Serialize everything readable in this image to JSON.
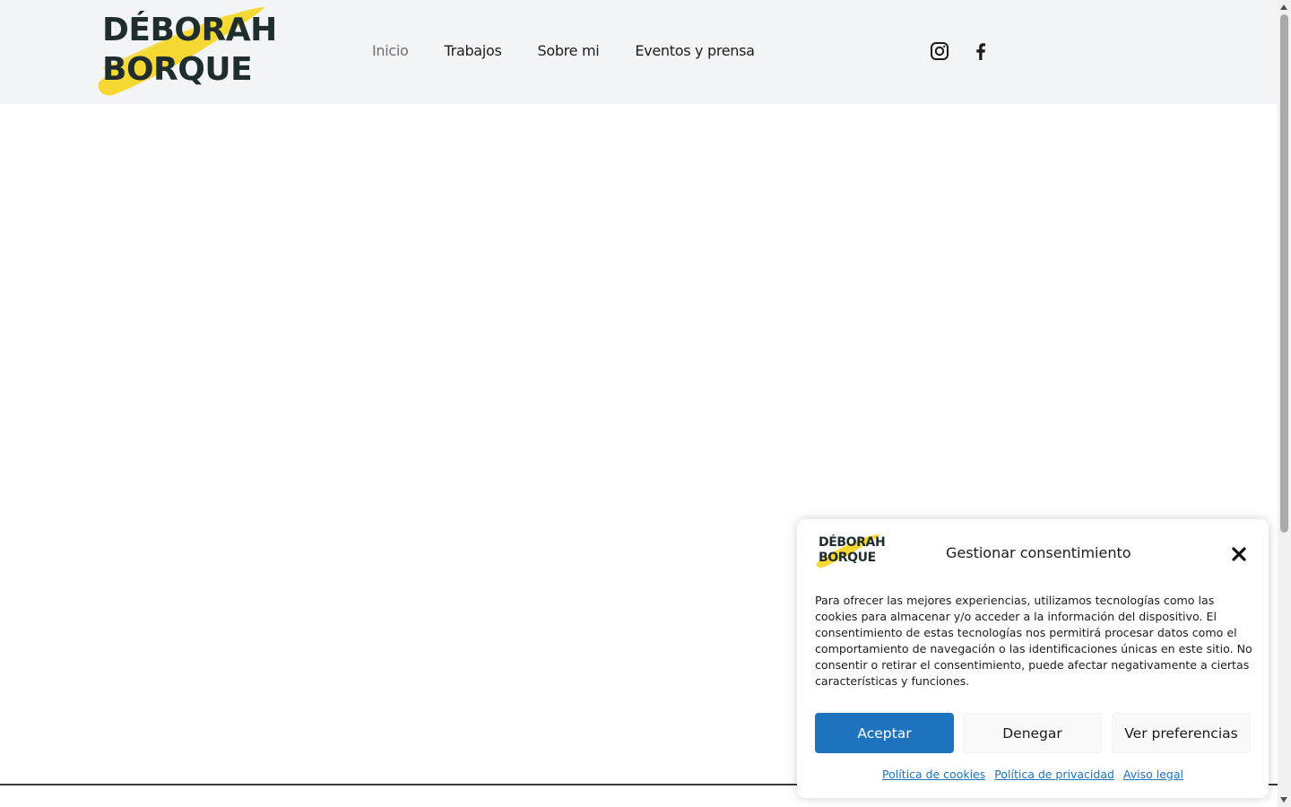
{
  "site": {
    "logo_line1": "DÉBORAH",
    "logo_line2": "BORQUE",
    "brush_color": "#f6d832",
    "text_color": "#1f2d2e"
  },
  "nav": {
    "items": [
      {
        "label": "Inicio",
        "active": true
      },
      {
        "label": "Trabajos",
        "active": false
      },
      {
        "label": "Sobre mi",
        "active": false
      },
      {
        "label": "Eventos y prensa",
        "active": false
      }
    ]
  },
  "social": {
    "icons": [
      "instagram-icon",
      "facebook-icon"
    ]
  },
  "consent": {
    "logo_line1": "DÉBORAH",
    "logo_line2": "BORQUE",
    "title": "Gestionar consentimiento",
    "body": "Para ofrecer las mejores experiencias, utilizamos tecnologías como las cookies para almacenar y/o acceder a la información del dispositivo. El consentimiento de estas tecnologías nos permitirá procesar datos como el comportamiento de navegación o las identificaciones únicas en este sitio. No consentir o retirar el consentimiento, puede afectar negativamente a ciertas características y funciones.",
    "accept_label": "Aceptar",
    "deny_label": "Denegar",
    "prefs_label": "Ver preferencias",
    "links": [
      "Política de cookies",
      "Política de privacidad",
      "Aviso legal"
    ],
    "accent_color": "#1e73be"
  }
}
